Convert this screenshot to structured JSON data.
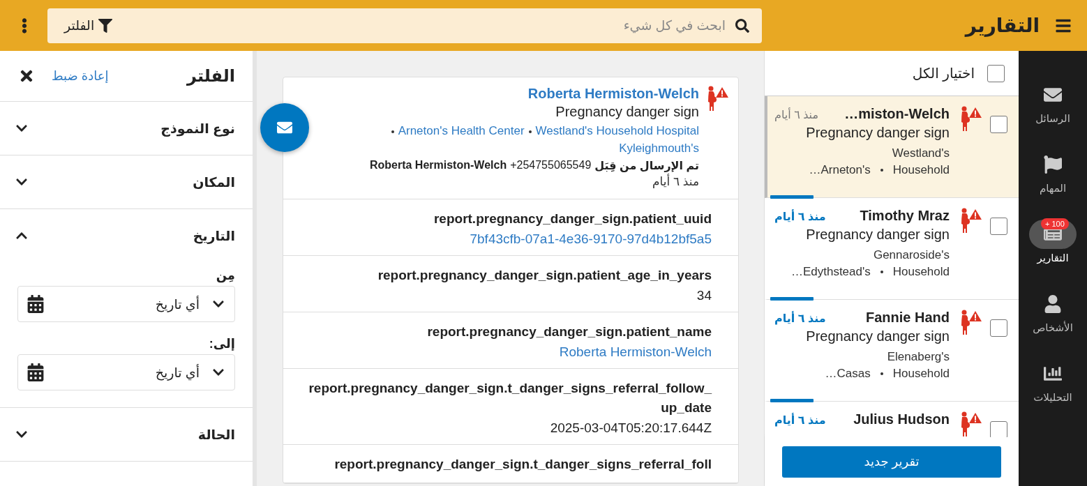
{
  "header": {
    "title": "التقارير",
    "search": {
      "placeholder": "ابحث في كل شيء"
    },
    "filter_button": "الفلتر"
  },
  "nav": [
    {
      "label": "الرسائل",
      "selected": false
    },
    {
      "label": "المهام",
      "selected": false
    },
    {
      "label": "التقارير",
      "selected": true,
      "badge": "+ 100"
    },
    {
      "label": "الأشخاص",
      "selected": false
    },
    {
      "label": "التحليلات",
      "selected": false
    }
  ],
  "report_list": {
    "select_all": {
      "label": "اختيار الكل",
      "checked": false
    },
    "items": [
      {
        "name": "…miston-Welch",
        "time": "منذ ٦ أيام",
        "form": "Pregnancy danger sign",
        "place": "Westland's",
        "lineage": [
          "Household",
          "Arneton's…"
        ],
        "read": true,
        "selected": true,
        "checked": false
      },
      {
        "name": "Timothy Mraz",
        "time": "منذ ٦ أيام",
        "form": "Pregnancy danger sign",
        "place": "Gennaroside's",
        "lineage": [
          "Household",
          "Edythstead's…"
        ],
        "read": false,
        "selected": false,
        "checked": false
      },
      {
        "name": "Fannie Hand",
        "time": "منذ ٦ أيام",
        "form": "Pregnancy danger sign",
        "place": "Elenaberg's",
        "lineage": [
          "Household",
          "Casas…"
        ],
        "read": false,
        "selected": false,
        "checked": false
      },
      {
        "name": "Julius Hudson",
        "time": "منذ ٦ أيام",
        "read": false,
        "selected": false,
        "checked": false
      }
    ],
    "new_report_button": "تقرير جديد"
  },
  "report": {
    "name": "Roberta Hermiston-Welch",
    "form": "Pregnancy danger sign",
    "lineage": [
      "Westland's Household Hospital",
      "Arneton's Health Center",
      "Kyleighmouth's"
    ],
    "sent_by_label": "تم الإرسال من قِبَل",
    "sent_by_phone": "+254755065549",
    "sent_by_name": "Roberta Hermiston-Welch",
    "time": "منذ ٦ أيام",
    "fields": [
      {
        "label": "report.pregnancy_danger_sign.patient_uuid",
        "value": "7bf43cfb-07a1-4e36-9170-97d4b12bf5a5",
        "kind": "link"
      },
      {
        "label": "report.pregnancy_danger_sign.patient_age_in_years",
        "value": "34",
        "kind": "text"
      },
      {
        "label": "report.pregnancy_danger_sign.patient_name",
        "value": "Roberta Hermiston-Welch",
        "kind": "link"
      },
      {
        "label": "report.pregnancy_danger_sign.t_danger_signs_referral_follow_up_date",
        "value": "2025-03-04T05:20:17.644Z",
        "kind": "text"
      },
      {
        "label": "report.pregnancy_danger_sign.t_danger_signs_referral_foll"
      }
    ]
  },
  "filter": {
    "title": "الفلتر",
    "reset": "إعادة ضبط",
    "sections": [
      {
        "label": "نوع النموذج",
        "expanded": false
      },
      {
        "label": "المكان",
        "expanded": false
      },
      {
        "label": "التاريخ",
        "expanded": true,
        "date_fields": [
          {
            "label": "مِن",
            "value": "أي تاريخ"
          },
          {
            "label": "إلى:",
            "value": "أي تاريخ"
          }
        ]
      },
      {
        "label": "الحالة",
        "expanded": false
      }
    ]
  }
}
